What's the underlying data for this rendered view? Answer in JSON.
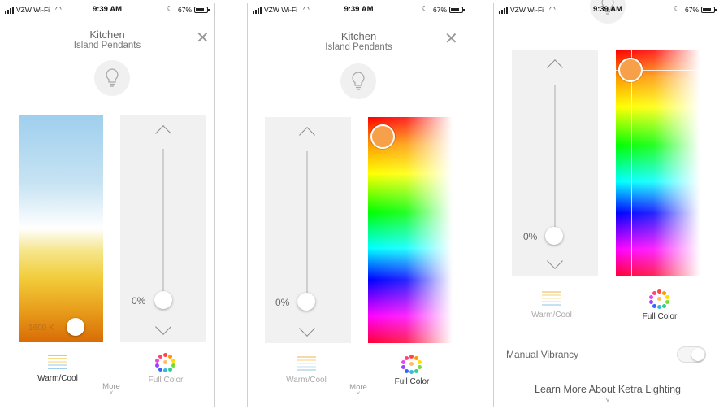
{
  "status": {
    "carrier": "VZW Wi-Fi",
    "time": "9:39 AM",
    "battery": "67%",
    "battery_level": 0.67
  },
  "device": {
    "room": "Kitchen",
    "name": "Island Pendants"
  },
  "screens": [
    {
      "mode": "warm_cool",
      "dimmer_value": "0%",
      "color_temp": "1600 K"
    },
    {
      "mode": "full_color",
      "dimmer_value": "0%"
    },
    {
      "mode": "full_color",
      "dimmer_value": "0%",
      "manual_vibrancy_label": "Manual Vibrancy",
      "manual_vibrancy_on": false,
      "learn_more": "Learn More About Ketra Lighting"
    }
  ],
  "tabs": {
    "warm_cool": "Warm/Cool",
    "full_color": "Full Color",
    "more": "More"
  },
  "icons": {
    "close": "close-icon",
    "bulb": "lightbulb-icon",
    "warm_cool": "warm-cool-lines-icon",
    "full_color": "color-wheel-dots-icon"
  }
}
